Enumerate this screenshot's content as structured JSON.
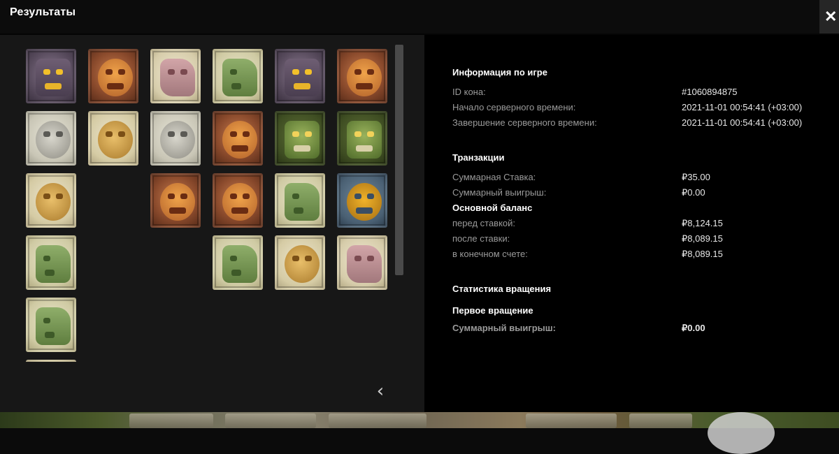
{
  "window": {
    "title": "Результаты",
    "close_glyph": "✕"
  },
  "reels": {
    "columns": [
      [
        "purple-mask",
        "silver-bird",
        "gold-serpent",
        "green-head",
        "green-head",
        "gold-serpent"
      ],
      [
        "orange-mask",
        "gold-serpent"
      ],
      [
        "pink-head",
        "silver-bird",
        "orange-mask"
      ],
      [
        "green-head",
        "orange-mask",
        "orange-mask",
        "green-head"
      ],
      [
        "purple-mask",
        "green-mask",
        "green-head",
        "gold-serpent"
      ],
      [
        "orange-mask",
        "green-mask",
        "blue-mask",
        "pink-head"
      ]
    ]
  },
  "navigation": {
    "prev_glyph": "‹",
    "next_glyph": "›"
  },
  "game_info": {
    "title": "Информация по игре",
    "rows": [
      {
        "label": "ID кона:",
        "value": "#1060894875"
      },
      {
        "label": "Начало серверного времени:",
        "value": "2021-11-01 00:54:41 (+03:00)"
      },
      {
        "label": "Завершение серверного времени:",
        "value": "2021-11-01 00:54:41 (+03:00)"
      }
    ]
  },
  "transactions": {
    "title": "Транзакции",
    "rows": [
      {
        "label": "Суммарная Ставка:",
        "value": "₽35.00"
      },
      {
        "label": "Суммарный выигрыш:",
        "value": "₽0.00"
      }
    ],
    "balance_title": "Основной баланс",
    "balance_rows": [
      {
        "label": "перед ставкой:",
        "value": "₽8,124.15"
      },
      {
        "label": "после ставки:",
        "value": "₽8,089.15"
      },
      {
        "label": "в конечном счете:",
        "value": "₽8,089.15"
      }
    ]
  },
  "spin_stats": {
    "title": "Статистика вращения",
    "first_spin_title": "Первое вращение",
    "rows": [
      {
        "label": "Суммарный выигрыш:",
        "value": "₽0.00"
      }
    ]
  },
  "colors": {
    "panel_left": "#171717",
    "panel_right": "#000000",
    "label_gray": "#9a9a9a"
  }
}
